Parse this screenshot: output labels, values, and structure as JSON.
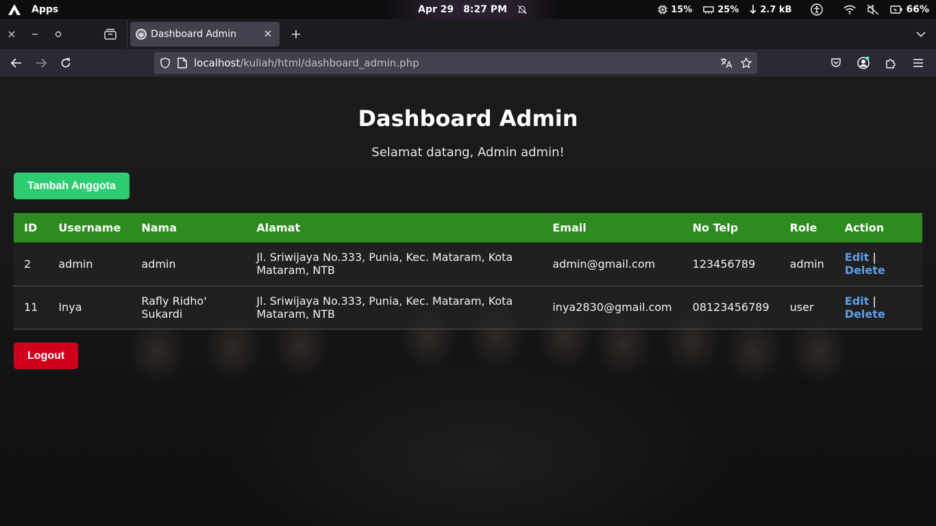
{
  "os": {
    "launcher": "Apps",
    "date": "Apr 29",
    "time": "8:27 PM",
    "cpu": "15%",
    "mem": "25%",
    "net": "2.7 kB",
    "battery": "66%"
  },
  "browser": {
    "tab_title": "Dashboard Admin",
    "url_host": "localhost",
    "url_path": "/kuliah/html/dashboard_admin.php"
  },
  "page": {
    "title": "Dashboard Admin",
    "welcome": "Selamat datang, Admin admin!",
    "add_button": "Tambah Anggota",
    "logout_button": "Logout",
    "table": {
      "headers": [
        "ID",
        "Username",
        "Nama",
        "Alamat",
        "Email",
        "No Telp",
        "Role",
        "Action"
      ],
      "rows": [
        {
          "id": "2",
          "username": "admin",
          "nama": "admin",
          "alamat": "Jl. Sriwijaya No.333, Punia, Kec. Mataram, Kota Mataram, NTB",
          "email": "admin@gmail.com",
          "telp": "123456789",
          "role": "admin",
          "edit": "Edit",
          "sep": "|",
          "delete": "Delete"
        },
        {
          "id": "11",
          "username": "Inya",
          "nama": "Rafly Ridho' Sukardi",
          "alamat": "Jl. Sriwijaya No.333, Punia, Kec. Mataram, Kota Mataram, NTB",
          "email": "inya2830@gmail.com",
          "telp": "08123456789",
          "role": "user",
          "edit": "Edit",
          "sep": "|",
          "delete": "Delete"
        }
      ]
    }
  },
  "colors": {
    "add_button": "#2ecc71",
    "logout_button": "#d0021b",
    "table_header": "#2e8b20",
    "link": "#5aa0ea"
  }
}
